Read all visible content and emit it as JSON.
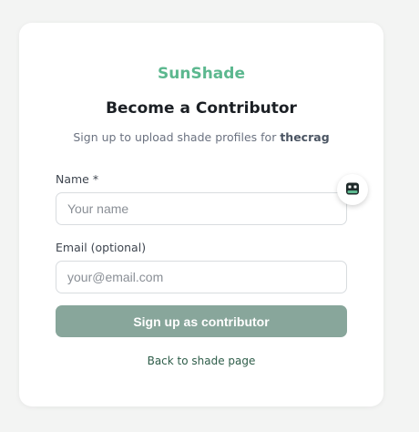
{
  "brand": {
    "name": "SunShade",
    "color": "#5cb88f"
  },
  "header": {
    "title": "Become a Contributor",
    "subtitle_prefix": "Sign up to upload shade profiles for ",
    "subtitle_site": "thecrag"
  },
  "form": {
    "name_label": "Name *",
    "name_placeholder": "Your name",
    "name_value": "",
    "email_label": "Email (optional)",
    "email_placeholder": "your@email.com",
    "email_value": "",
    "submit_label": "Sign up as contributor",
    "submit_color": "#88a69b"
  },
  "footer": {
    "back_link": "Back to shade page"
  },
  "widget": {
    "icon": "assistant-bot-icon"
  }
}
